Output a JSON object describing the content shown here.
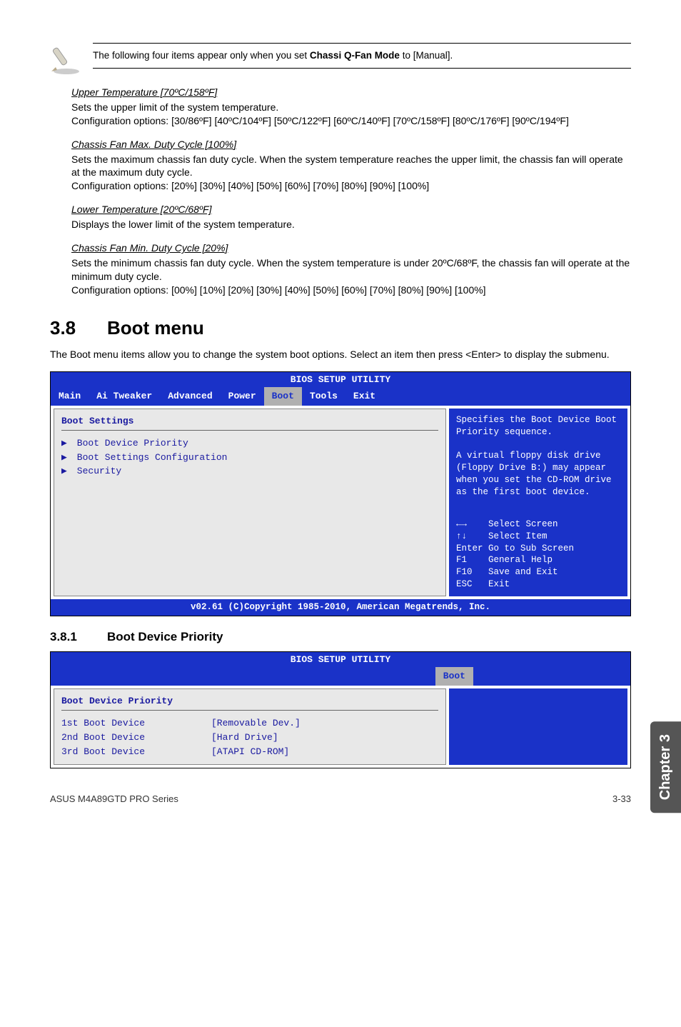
{
  "note": {
    "text": "The following four items appear only when you set ",
    "bold": "Chassi Q-Fan Mode",
    "tail": " to [Manual]."
  },
  "fields": [
    {
      "title": "Upper Temperature [70ºC/158ºF]",
      "body": "Sets the upper limit of the system temperature.\nConfiguration options: [30/86ºF] [40ºC/104ºF] [50ºC/122ºF] [60ºC/140ºF] [70ºC/158ºF] [80ºC/176ºF] [90ºC/194ºF]"
    },
    {
      "title": "Chassis Fan Max. Duty Cycle [100%]",
      "body": "Sets the maximum chassis fan duty cycle. When the system temperature reaches the upper limit, the chassis fan will operate at the maximum duty cycle.\nConfiguration options: [20%] [30%] [40%] [50%] [60%] [70%] [80%] [90%] [100%]"
    },
    {
      "title": "Lower Temperature [20ºC/68ºF]",
      "body": "Displays the lower limit of the system temperature."
    },
    {
      "title": "Chassis Fan Min. Duty Cycle [20%]",
      "body": "Sets the minimum chassis fan duty cycle. When the system temperature is under 20ºC/68ºF, the chassis fan will operate at the minimum duty cycle.\nConfiguration options: [00%] [10%] [20%] [30%] [40%] [50%] [60%] [70%] [80%] [90%] [100%]"
    }
  ],
  "section": {
    "num": "3.8",
    "title": "Boot menu"
  },
  "section_intro": "The Boot menu items allow you to change the system boot options. Select an item then press <Enter> to display the submenu.",
  "bios1": {
    "title": "BIOS SETUP UTILITY",
    "tabs": [
      "Main",
      "Ai Tweaker",
      "Advanced",
      "Power",
      "Boot",
      "Tools",
      "Exit"
    ],
    "active_tab": "Boot",
    "heading": "Boot Settings",
    "items": [
      "Boot Device Priority",
      "Boot Settings Configuration",
      "Security"
    ],
    "help_top": "Specifies the Boot Device Boot Priority sequence.\n\nA virtual floppy disk drive (Floppy Drive B:) may appear when you set the CD-ROM drive as the first boot device.",
    "help_keys": [
      "←→    Select Screen",
      "↑↓    Select Item",
      "Enter Go to Sub Screen",
      "F1    General Help",
      "F10   Save and Exit",
      "ESC   Exit"
    ],
    "footer": "v02.61 (C)Copyright 1985-2010, American Megatrends, Inc."
  },
  "subsection": {
    "num": "3.8.1",
    "title": "Boot Device Priority"
  },
  "bios2": {
    "title": "BIOS SETUP UTILITY",
    "active_tab": "Boot",
    "heading": "Boot Device Priority",
    "rows": [
      {
        "k": "1st Boot Device",
        "v": "[Removable Dev.]"
      },
      {
        "k": "2nd Boot Device",
        "v": "[Hard Drive]"
      },
      {
        "k": "3rd Boot Device",
        "v": "[ATAPI CD-ROM]"
      }
    ]
  },
  "side_tab": "Chapter 3",
  "footer": {
    "left": "ASUS M4A89GTD PRO Series",
    "right": "3-33"
  }
}
